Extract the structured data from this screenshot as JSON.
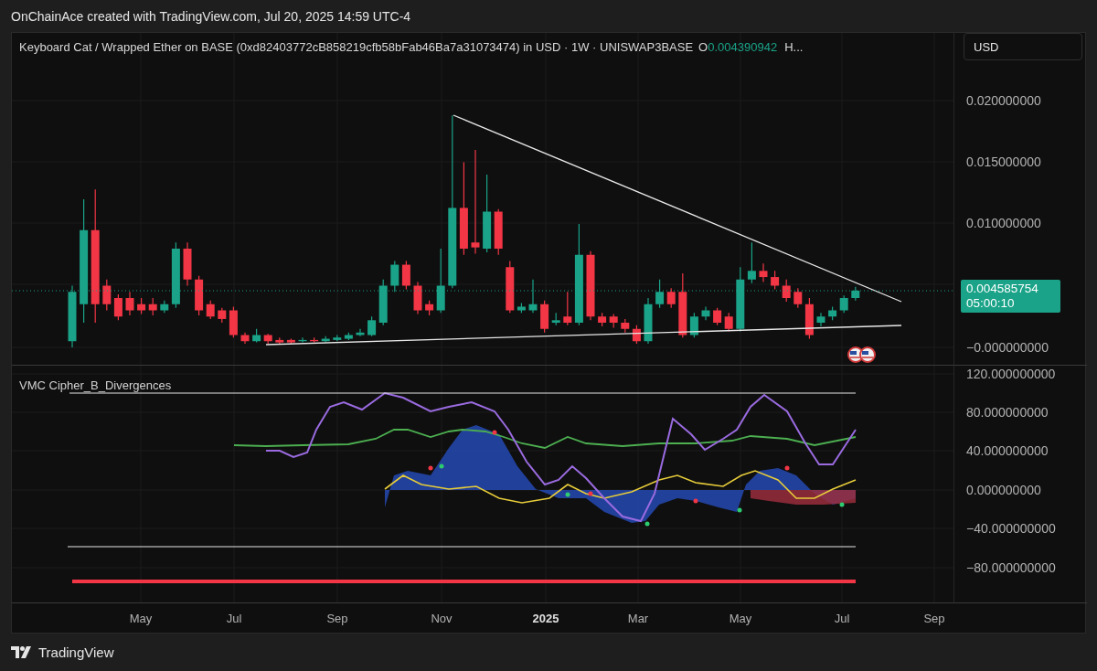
{
  "header": {
    "text": "OnChainAce created with TradingView.com, Jul 20, 2025 14:59 UTC-4"
  },
  "legend": {
    "symbol": "Keyboard Cat / Wrapped Ether on BASE (0xd82403772cB858219cfb58bFab46Ba7a31073474) in USD · 1W · UNISWAP3BASE",
    "open_label": "O",
    "open_value": "0.004390942",
    "more": "H..."
  },
  "currency_button": {
    "label": "USD"
  },
  "price_axis": {
    "ticks": [
      "0.020000000",
      "0.015000000",
      "0.010000000",
      "−0.000000000"
    ]
  },
  "last_price": {
    "value": "0.004585754",
    "countdown": "05:00:10"
  },
  "indicator": {
    "name": "VMC Cipher_B_Divergences",
    "ticks": [
      "120.000000000",
      "80.000000000",
      "40.000000000",
      "0.000000000",
      "−40.000000000",
      "−80.000000000"
    ]
  },
  "time_axis": [
    {
      "label": "May",
      "kind": "month"
    },
    {
      "label": "Jul",
      "kind": "month"
    },
    {
      "label": "Sep",
      "kind": "month"
    },
    {
      "label": "Nov",
      "kind": "month"
    },
    {
      "label": "2025",
      "kind": "year"
    },
    {
      "label": "Mar",
      "kind": "month"
    },
    {
      "label": "May",
      "kind": "month"
    },
    {
      "label": "Jul",
      "kind": "month"
    },
    {
      "label": "Sep",
      "kind": "month"
    }
  ],
  "footer": {
    "brand": "TradingView"
  }
}
